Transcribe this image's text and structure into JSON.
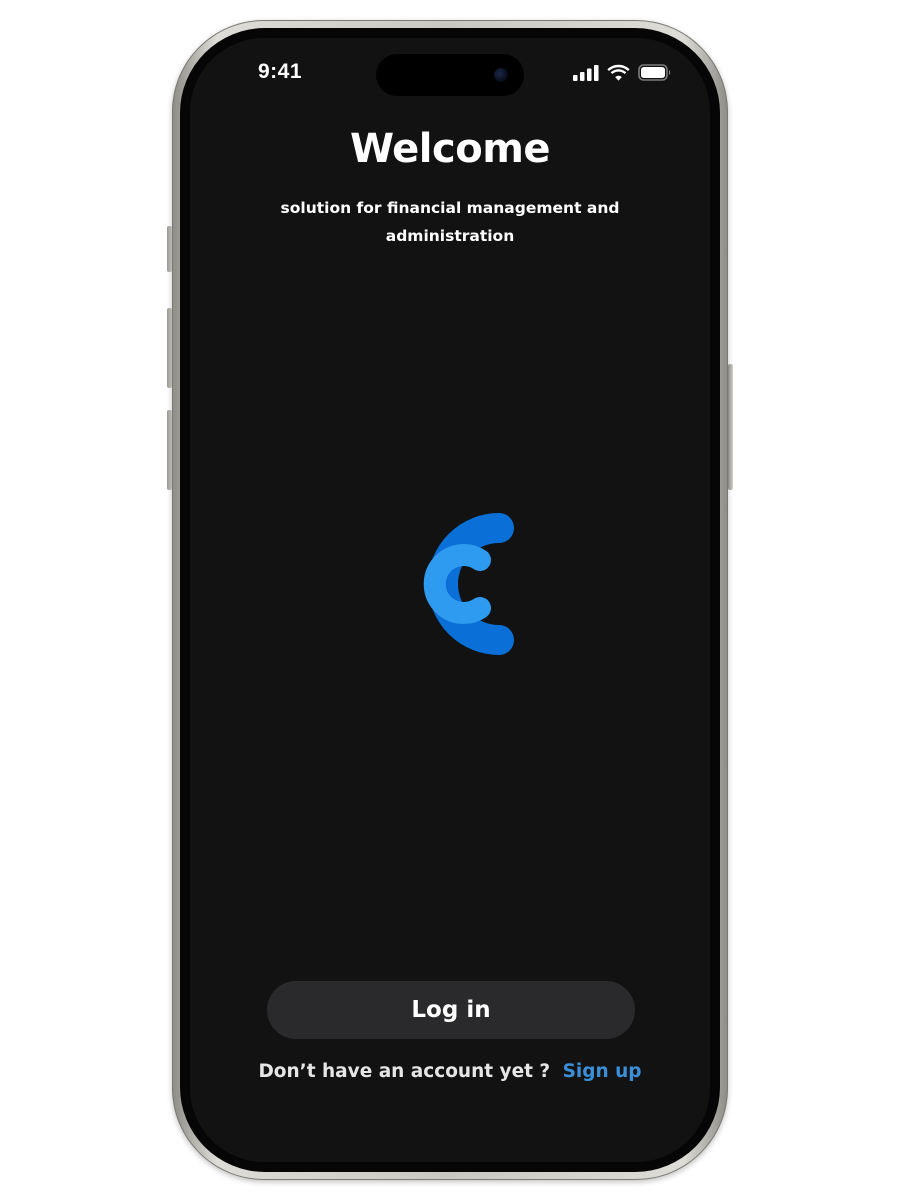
{
  "status_bar": {
    "time": "9:41",
    "signal_icon": "cellular-signal-icon",
    "wifi_icon": "wifi-icon",
    "battery_icon": "battery-icon"
  },
  "welcome": {
    "title": "Welcome",
    "subtitle": "solution for financial management and administration"
  },
  "logo": {
    "icon": "app-logo-icon",
    "outer_color": "#0a6fd6",
    "inner_color": "#2f9bf0"
  },
  "actions": {
    "login_label": "Log in",
    "signup_prompt": "Don’t have an account yet ?",
    "signup_label": "Sign up"
  },
  "colors": {
    "background": "#121212",
    "button": "#2a2a2c",
    "link": "#3b8fd8"
  }
}
